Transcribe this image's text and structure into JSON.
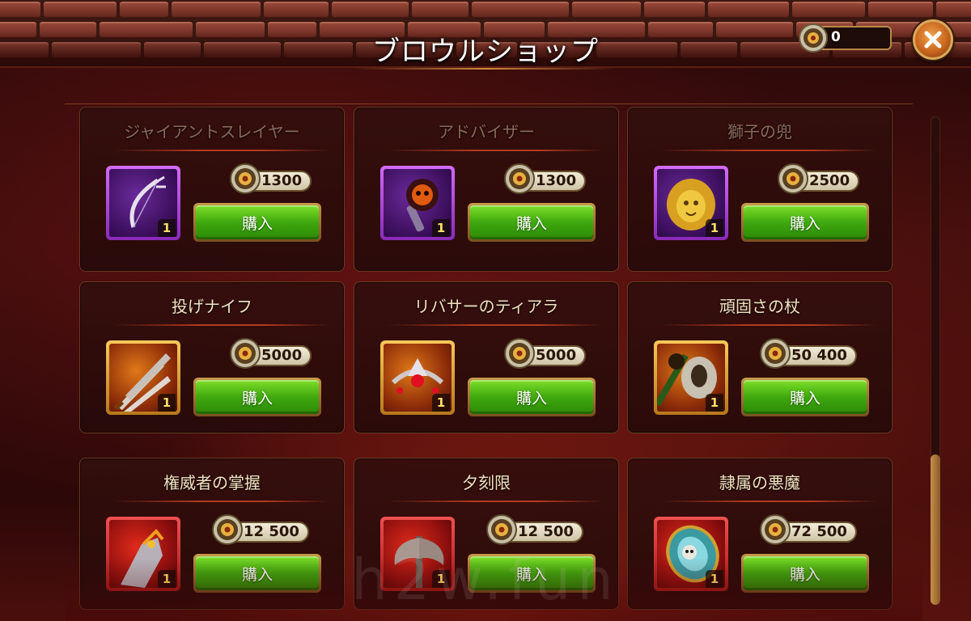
{
  "header": {
    "title": "ブロウルショップ",
    "currency": {
      "icon": "brawl-coin-icon",
      "value": "0"
    },
    "close_icon": "close-icon"
  },
  "colors": {
    "buy_green": "#3fa80e",
    "rare_purple": "#8a2ab8",
    "epic_gold": "#b8781c",
    "legendary_red": "#a81818"
  },
  "buy_label": "購入",
  "items": [
    {
      "name": "ジャイアントスレイヤー",
      "price": "1300",
      "count": "1",
      "rarity": "purple",
      "icon": "bow-icon"
    },
    {
      "name": "アドバイザー",
      "price": "1300",
      "count": "1",
      "rarity": "purple",
      "icon": "mace-icon"
    },
    {
      "name": "獅子の兜",
      "price": "2500",
      "count": "1",
      "rarity": "purple",
      "icon": "lion-helmet-icon"
    },
    {
      "name": "投げナイフ",
      "price": "5000",
      "count": "1",
      "rarity": "gold",
      "icon": "throwing-knives-icon"
    },
    {
      "name": "リバサーのティアラ",
      "price": "5000",
      "count": "1",
      "rarity": "gold",
      "icon": "tiara-icon"
    },
    {
      "name": "頑固さの杖",
      "price": "50 400",
      "count": "1",
      "rarity": "gold",
      "icon": "staff-icon"
    },
    {
      "name": "権威者の掌握",
      "price": "12 500",
      "count": "1",
      "rarity": "red",
      "icon": "gauntlet-icon"
    },
    {
      "name": "夕刻限",
      "price": "12 500",
      "count": "1",
      "rarity": "red",
      "icon": "axe-icon"
    },
    {
      "name": "隷属の悪魔",
      "price": "72 500",
      "count": "1",
      "rarity": "red",
      "icon": "mirror-icon"
    }
  ],
  "watermark": "h2w.fun"
}
